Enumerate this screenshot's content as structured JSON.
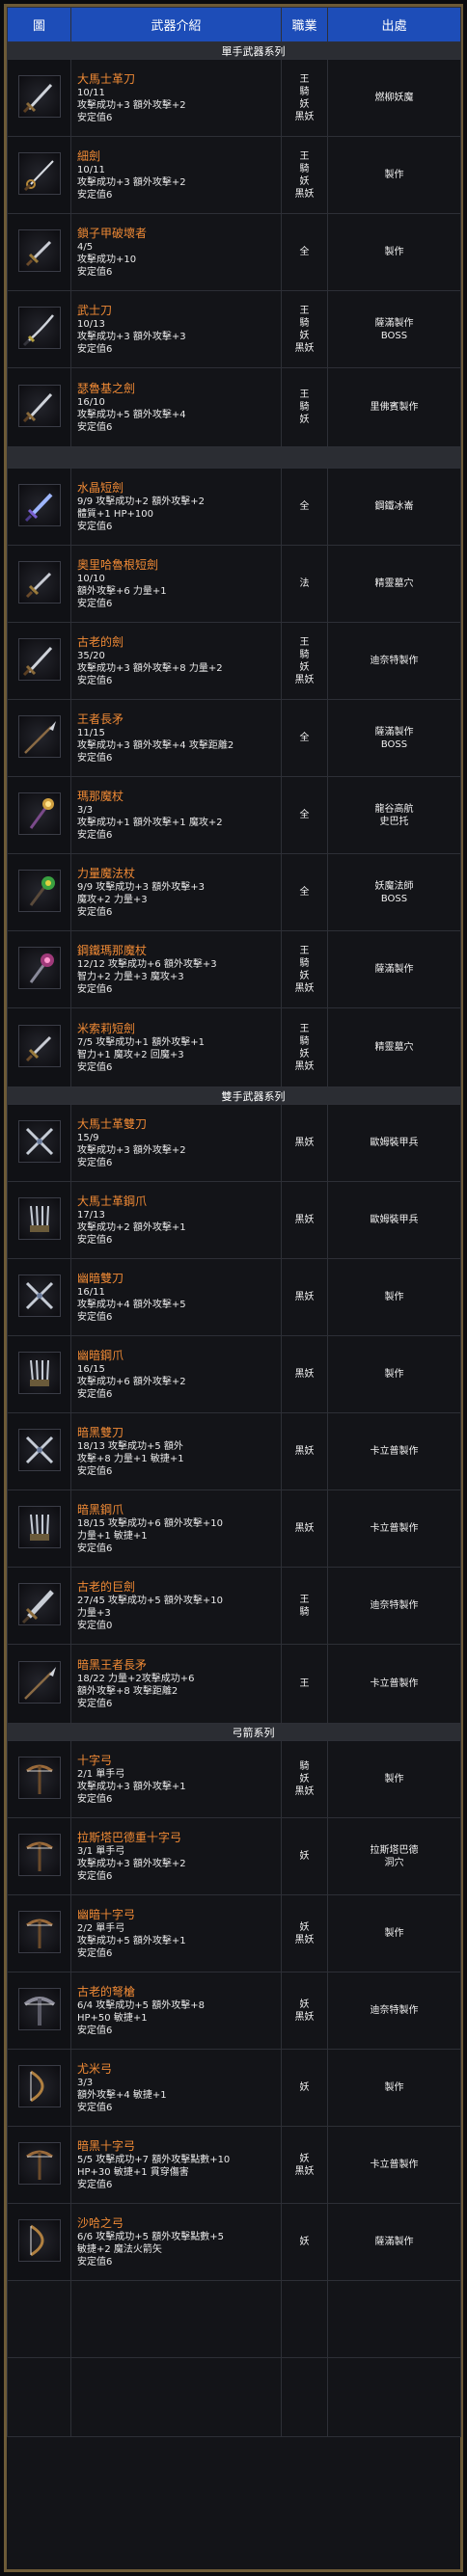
{
  "headers": [
    "圖",
    "武器介紹",
    "職業",
    "出處"
  ],
  "sections": [
    {
      "title": "單手武器系列",
      "rows": [
        {
          "name": "大馬士革刀",
          "lines": [
            "10/11",
            "攻擊成功+3 額外攻擊+2",
            "安定值6"
          ],
          "jobs": [
            "王",
            "騎",
            "妖",
            "黑妖"
          ],
          "src": [
            "燃柳妖魔"
          ],
          "icon": "sword-icon",
          "h": 80
        },
        {
          "name": "細劍",
          "lines": [
            "10/11",
            "攻擊成功+3 額外攻擊+2",
            "安定值6"
          ],
          "jobs": [
            "王",
            "騎",
            "妖",
            "黑妖"
          ],
          "src": [
            "製作"
          ],
          "icon": "rapier-icon",
          "h": 80
        },
        {
          "name": "鎖子甲破壞者",
          "lines": [
            "4/5",
            "攻擊成功+10",
            "安定值6"
          ],
          "jobs": [
            "全"
          ],
          "src": [
            "製作"
          ],
          "icon": "dagger-icon",
          "h": 80
        },
        {
          "name": "武士刀",
          "lines": [
            "10/13",
            "攻擊成功+3 額外攻擊+3",
            "安定值6"
          ],
          "jobs": [
            "王",
            "騎",
            "妖",
            "黑妖"
          ],
          "src": [
            "薩滿製作",
            "BOSS"
          ],
          "icon": "katana-icon",
          "h": 80
        },
        {
          "name": "瑟魯基之劍",
          "lines": [
            "16/10",
            "攻擊成功+5 額外攻擊+4",
            "安定值6"
          ],
          "jobs": [
            "王",
            "騎",
            "妖"
          ],
          "src": [
            "里佛賓製作"
          ],
          "icon": "sword-icon",
          "h": 82
        }
      ]
    },
    {
      "title": "",
      "rows": [
        {
          "name": "水晶短劍",
          "lines": [
            "9/9 攻擊成功+2 額外攻擊+2",
            "體質+1 HP+100",
            "安定值6"
          ],
          "jobs": [
            "全"
          ],
          "src": [
            "鋼鐵冰崙"
          ],
          "icon": "crystal-dagger-icon",
          "h": 80
        },
        {
          "name": "奧里哈魯根短劍",
          "lines": [
            "10/10",
            "額外攻擊+6 力量+1",
            "安定值6"
          ],
          "jobs": [
            "法"
          ],
          "src": [
            "精靈墓穴"
          ],
          "icon": "dagger-icon",
          "h": 80
        },
        {
          "name": "古老的劍",
          "lines": [
            "35/20",
            "攻擊成功+3 額外攻擊+8 力量+2",
            "安定值6"
          ],
          "jobs": [
            "王",
            "騎",
            "妖",
            "黑妖"
          ],
          "src": [
            "迪奈特製作"
          ],
          "icon": "sword-icon",
          "h": 80
        },
        {
          "name": "王者長矛",
          "lines": [
            "11/15",
            "攻擊成功+3 額外攻擊+4 攻擊距離2",
            "安定值6"
          ],
          "jobs": [
            "全"
          ],
          "src": [
            "薩滿製作",
            "BOSS"
          ],
          "icon": "spear-icon",
          "h": 80
        },
        {
          "name": "瑪那魔杖",
          "lines": [
            "3/3",
            "攻擊成功+1 額外攻擊+1 魔攻+2",
            "安定值6"
          ],
          "jobs": [
            "全"
          ],
          "src": [
            "龍谷高航",
            "史巴托"
          ],
          "icon": "wand-icon",
          "h": 80
        },
        {
          "name": "力量魔法杖",
          "lines": [
            "9/9 攻擊成功+3 額外攻擊+3",
            "魔攻+2 力量+3",
            "安定值6"
          ],
          "jobs": [
            "全"
          ],
          "src": [
            "妖魔法師",
            "BOSS"
          ],
          "icon": "staff-icon",
          "h": 80
        },
        {
          "name": "鋼鐵瑪那魔杖",
          "lines": [
            "12/12 攻擊成功+6 額外攻擊+3",
            "智力+2 力量+3 魔攻+3",
            "安定值6"
          ],
          "jobs": [
            "王",
            "騎",
            "妖",
            "黑妖"
          ],
          "src": [
            "薩滿製作"
          ],
          "icon": "mace-icon",
          "h": 80
        },
        {
          "name": "米索莉短劍",
          "lines": [
            "7/5 攻擊成功+1 額外攻擊+1",
            "智力+1 魔攻+2 回魔+3",
            "安定值6"
          ],
          "jobs": [
            "王",
            "騎",
            "妖",
            "黑妖"
          ],
          "src": [
            "精靈墓穴"
          ],
          "icon": "dagger-icon",
          "h": 82
        }
      ]
    },
    {
      "title": "雙手武器系列",
      "rows": [
        {
          "name": "大馬士革雙刀",
          "lines": [
            "15/9",
            "攻擊成功+3 額外攻擊+2",
            "安定值6"
          ],
          "jobs": [
            "黑妖"
          ],
          "src": [
            "歐姆裝甲兵"
          ],
          "icon": "dual-blade-icon",
          "h": 80
        },
        {
          "name": "大馬士革鋼爪",
          "lines": [
            "17/13",
            "攻擊成功+2 額外攻擊+1",
            "安定值6"
          ],
          "jobs": [
            "黑妖"
          ],
          "src": [
            "歐姆裝甲兵"
          ],
          "icon": "claw-icon",
          "h": 80
        },
        {
          "name": "幽暗雙刀",
          "lines": [
            "16/11",
            "攻擊成功+4 額外攻擊+5",
            "安定值6"
          ],
          "jobs": [
            "黑妖"
          ],
          "src": [
            "製作"
          ],
          "icon": "dual-blade-icon",
          "h": 80
        },
        {
          "name": "幽暗鋼爪",
          "lines": [
            "16/15",
            "攻擊成功+6 額外攻擊+2",
            "安定值6"
          ],
          "jobs": [
            "黑妖"
          ],
          "src": [
            "製作"
          ],
          "icon": "claw-icon",
          "h": 80
        },
        {
          "name": "暗黑雙刀",
          "lines": [
            "18/13 攻擊成功+5 額外",
            "攻擊+8 力量+1 敏捷+1",
            "安定值6"
          ],
          "jobs": [
            "黑妖"
          ],
          "src": [
            "卡立普製作"
          ],
          "icon": "dual-blade-icon",
          "h": 80
        },
        {
          "name": "暗黑鋼爪",
          "lines": [
            "18/15 攻擊成功+6 額外攻擊+10",
            "力量+1 敏捷+1",
            "安定值6"
          ],
          "jobs": [
            "黑妖"
          ],
          "src": [
            "卡立普製作"
          ],
          "icon": "claw-icon",
          "h": 80
        },
        {
          "name": "古老的巨劍",
          "lines": [
            "27/45 攻擊成功+5 額外攻擊+10",
            "力量+3",
            "安定值0"
          ],
          "jobs": [
            "王",
            "騎"
          ],
          "src": [
            "迪奈特製作"
          ],
          "icon": "greatsword-icon",
          "h": 80
        },
        {
          "name": "暗黑王者長矛",
          "lines": [
            "18/22 力量+2攻擊成功+6",
            "額外攻擊+8 攻擊距離2",
            "安定值6"
          ],
          "jobs": [
            "王"
          ],
          "src": [
            "卡立普製作"
          ],
          "icon": "spear-icon",
          "h": 82
        }
      ]
    },
    {
      "title": "弓箭系列",
      "rows": [
        {
          "name": "十字弓",
          "lines": [
            "2/1 單手弓",
            "攻擊成功+3 額外攻擊+1",
            "安定值6"
          ],
          "jobs": [
            "騎",
            "妖",
            "黑妖"
          ],
          "src": [
            "製作"
          ],
          "icon": "crossbow-icon",
          "h": 80
        },
        {
          "name": "拉斯塔巴德重十字弓",
          "lines": [
            "3/1 單手弓",
            "攻擊成功+3 額外攻擊+2",
            "安定值6"
          ],
          "jobs": [
            "妖"
          ],
          "src": [
            "拉斯塔巴德",
            "洞穴"
          ],
          "icon": "crossbow-icon",
          "h": 80
        },
        {
          "name": "幽暗十字弓",
          "lines": [
            "2/2 單手弓",
            "攻擊成功+5 額外攻擊+1",
            "安定值6"
          ],
          "jobs": [
            "妖",
            "黑妖"
          ],
          "src": [
            "製作"
          ],
          "icon": "crossbow-icon",
          "h": 80
        },
        {
          "name": "古老的弩槍",
          "lines": [
            "6/4 攻擊成功+5 額外攻擊+8",
            "HP+50 敏捷+1",
            "安定值6"
          ],
          "jobs": [
            "妖",
            "黑妖"
          ],
          "src": [
            "迪奈特製作"
          ],
          "icon": "heavy-crossbow-icon",
          "h": 80
        },
        {
          "name": "尤米弓",
          "lines": [
            "3/3",
            "額外攻擊+4 敏捷+1",
            "安定值6"
          ],
          "jobs": [
            "妖"
          ],
          "src": [
            "製作"
          ],
          "icon": "bow-icon",
          "h": 80
        },
        {
          "name": "暗黑十字弓",
          "lines": [
            "5/5 攻擊成功+7 額外攻擊點數+10",
            "HP+30 敏捷+1 貫穿傷害",
            "安定值6"
          ],
          "jobs": [
            "妖",
            "黑妖"
          ],
          "src": [
            "卡立普製作"
          ],
          "icon": "crossbow-icon",
          "h": 80
        },
        {
          "name": "沙哈之弓",
          "lines": [
            "6/6 攻擊成功+5 額外攻擊點數+5",
            "敏捷+2 魔法火箭矢",
            "安定值6"
          ],
          "jobs": [
            "妖"
          ],
          "src": [
            "薩滿製作"
          ],
          "icon": "bow-icon",
          "h": 80
        }
      ]
    }
  ],
  "empty_rows": 2
}
